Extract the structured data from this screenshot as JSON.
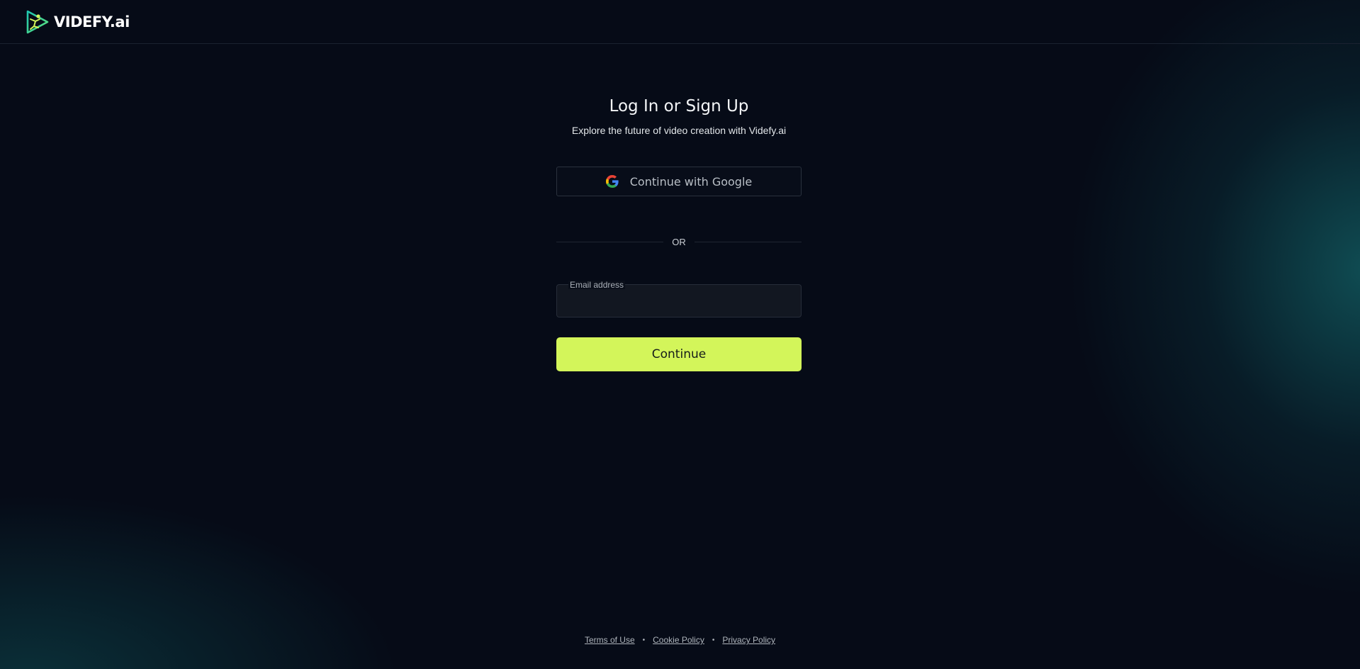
{
  "header": {
    "logo_text": "VIDEFY.ai",
    "logo_icon": "play-triangle-figure-icon"
  },
  "auth": {
    "title": "Log In or Sign Up",
    "subtitle": "Explore the future of video creation with Videfy.ai",
    "google_button_label": "Continue with Google",
    "google_icon": "google-g-icon",
    "divider_text": "OR",
    "email_label": "Email address",
    "email_value": "",
    "continue_label": "Continue"
  },
  "footer": {
    "links": [
      "Terms of Use",
      "Cookie Policy",
      "Privacy Policy"
    ],
    "separator": "•"
  },
  "colors": {
    "background": "#060b17",
    "accent": "#d3f55a",
    "glow": "#125f64"
  }
}
